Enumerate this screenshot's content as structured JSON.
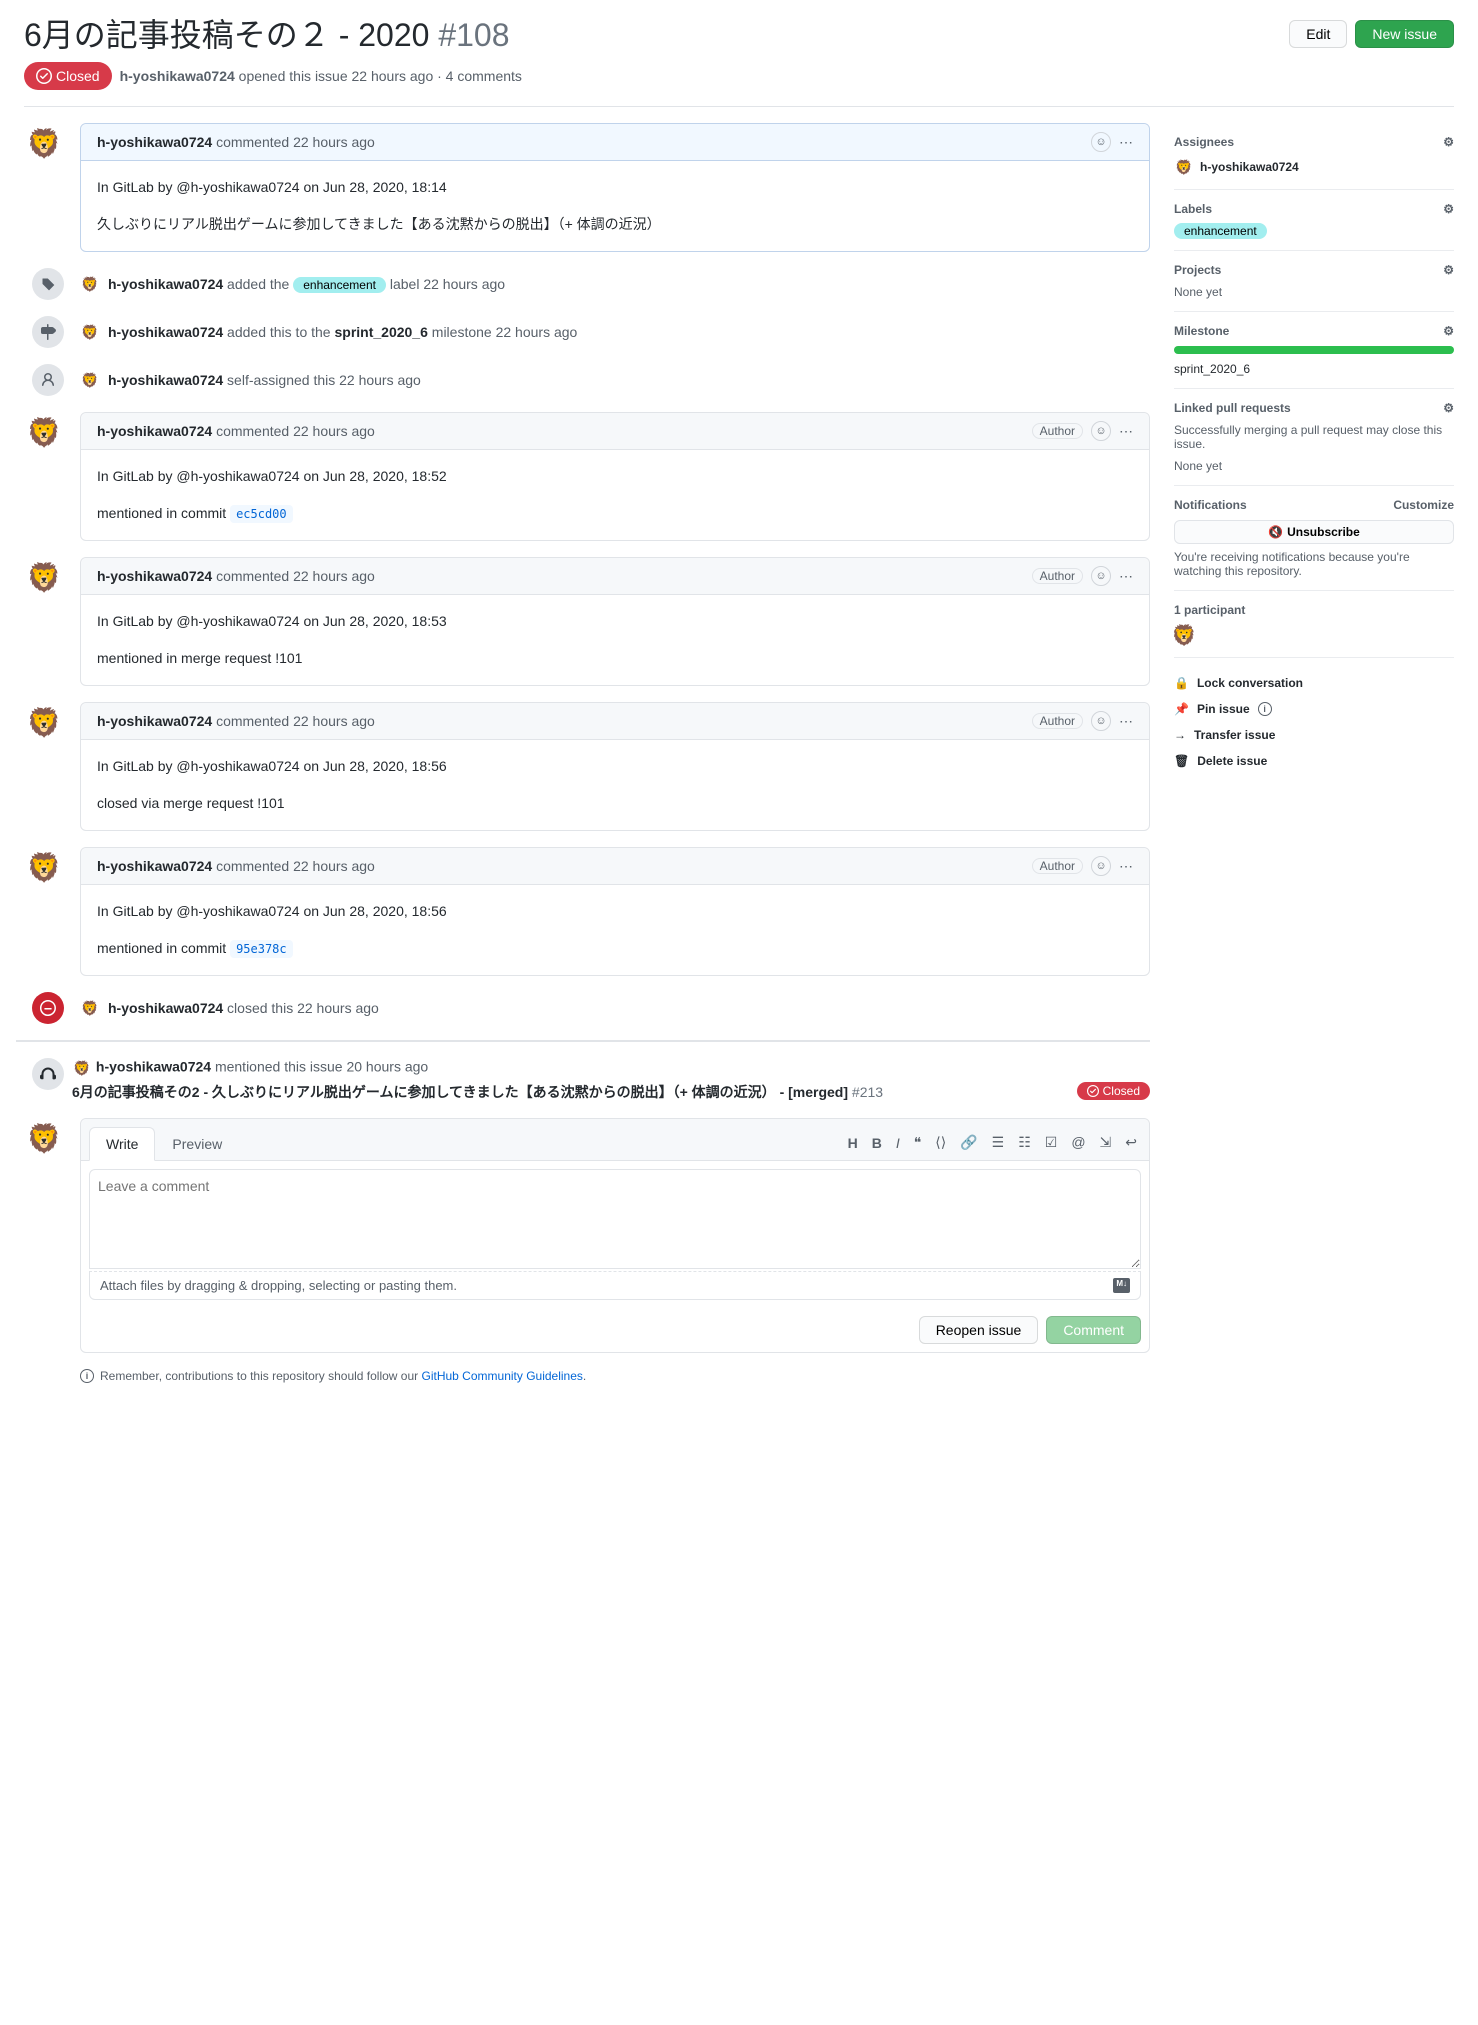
{
  "header": {
    "title": "6月の記事投稿その２ - 2020",
    "number": "#108",
    "edit": "Edit",
    "new_issue": "New issue"
  },
  "meta": {
    "state": "Closed",
    "author": "h-yoshikawa0724",
    "rest": " opened this issue 22 hours ago · 4 comments"
  },
  "comments": [
    {
      "author": "h-yoshikawa0724",
      "when": "commented 22 hours ago",
      "author_badge": false,
      "lines": [
        "In GitLab by @h-yoshikawa0724 on Jun 28, 2020, 18:14",
        "久しぶりにリアル脱出ゲームに参加してきました【ある沈黙からの脱出】（+ 体調の近況）"
      ]
    },
    {
      "author": "h-yoshikawa0724",
      "when": "commented 22 hours ago",
      "author_badge": true,
      "lines": [
        "In GitLab by @h-yoshikawa0724 on Jun 28, 2020, 18:52",
        "mentioned in commit "
      ],
      "commit": "ec5cd00"
    },
    {
      "author": "h-yoshikawa0724",
      "when": "commented 22 hours ago",
      "author_badge": true,
      "lines": [
        "In GitLab by @h-yoshikawa0724 on Jun 28, 2020, 18:53",
        "mentioned in merge request !101"
      ]
    },
    {
      "author": "h-yoshikawa0724",
      "when": "commented 22 hours ago",
      "author_badge": true,
      "lines": [
        "In GitLab by @h-yoshikawa0724 on Jun 28, 2020, 18:56",
        "closed via merge request !101"
      ]
    },
    {
      "author": "h-yoshikawa0724",
      "when": "commented 22 hours ago",
      "author_badge": true,
      "lines": [
        "In GitLab by @h-yoshikawa0724 on Jun 28, 2020, 18:56",
        "mentioned in commit "
      ],
      "commit": "95e378c"
    }
  ],
  "events": {
    "label": {
      "user": "h-yoshikawa0724",
      "pre": " added the ",
      "label": "enhancement",
      "post": " label 22 hours ago"
    },
    "milestone": {
      "user": "h-yoshikawa0724",
      "pre": " added this to the ",
      "ms": "sprint_2020_6",
      "post": " milestone 22 hours ago"
    },
    "assign": {
      "user": "h-yoshikawa0724",
      "text": " self-assigned this 22 hours ago"
    },
    "closed": {
      "user": "h-yoshikawa0724",
      "text": " closed this 22 hours ago"
    }
  },
  "reference": {
    "header_user": "h-yoshikawa0724",
    "header_rest": " mentioned this issue 20 hours ago",
    "title": "6月の記事投稿その2 - 久しぶりにリアル脱出ゲームに参加してきました【ある沈黙からの脱出】（+ 体調の近況） - [merged] ",
    "num": "#213",
    "state": "Closed"
  },
  "compose": {
    "write": "Write",
    "preview": "Preview",
    "placeholder": "Leave a comment",
    "attach": "Attach files by dragging & dropping, selecting or pasting them.",
    "reopen": "Reopen issue",
    "comment": "Comment"
  },
  "guideline": {
    "pre": "Remember, contributions to this repository should follow our ",
    "link": "GitHub Community Guidelines",
    "post": "."
  },
  "sidebar": {
    "assignees": {
      "title": "Assignees",
      "user": "h-yoshikawa0724"
    },
    "labels": {
      "title": "Labels",
      "value": "enhancement"
    },
    "projects": {
      "title": "Projects",
      "value": "None yet"
    },
    "milestone": {
      "title": "Milestone",
      "value": "sprint_2020_6"
    },
    "linked": {
      "title": "Linked pull requests",
      "desc": "Successfully merging a pull request may close this issue.",
      "value": "None yet"
    },
    "notifications": {
      "title": "Notifications",
      "customize": "Customize",
      "button": "Unsubscribe",
      "desc": "You're receiving notifications because you're watching this repository."
    },
    "participants": {
      "title": "1 participant"
    },
    "actions": {
      "lock": "Lock conversation",
      "pin": "Pin issue",
      "transfer": "Transfer issue",
      "delete": "Delete issue"
    }
  }
}
